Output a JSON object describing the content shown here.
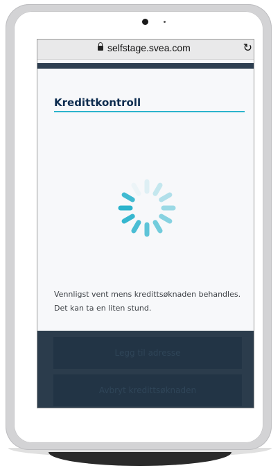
{
  "browser": {
    "url": "selfstage.svea.com",
    "lock_icon": "lock-icon",
    "reload_icon": "reload-icon"
  },
  "page": {
    "title": "Kredittkontroll",
    "spinner_icon": "loading-spinner-icon",
    "message_line1": "Vennligst vent mens kredittsøknaden behandles.",
    "message_line2": "Det kan ta en liten stund."
  },
  "footer": {
    "primary_button_label": "Legg til adresse",
    "secondary_button_label": "Avbryt kredittsøknaden"
  },
  "colors": {
    "accent": "#2bb3cc",
    "title": "#0d2c4f",
    "footer_bg": "#2b3c4c"
  }
}
